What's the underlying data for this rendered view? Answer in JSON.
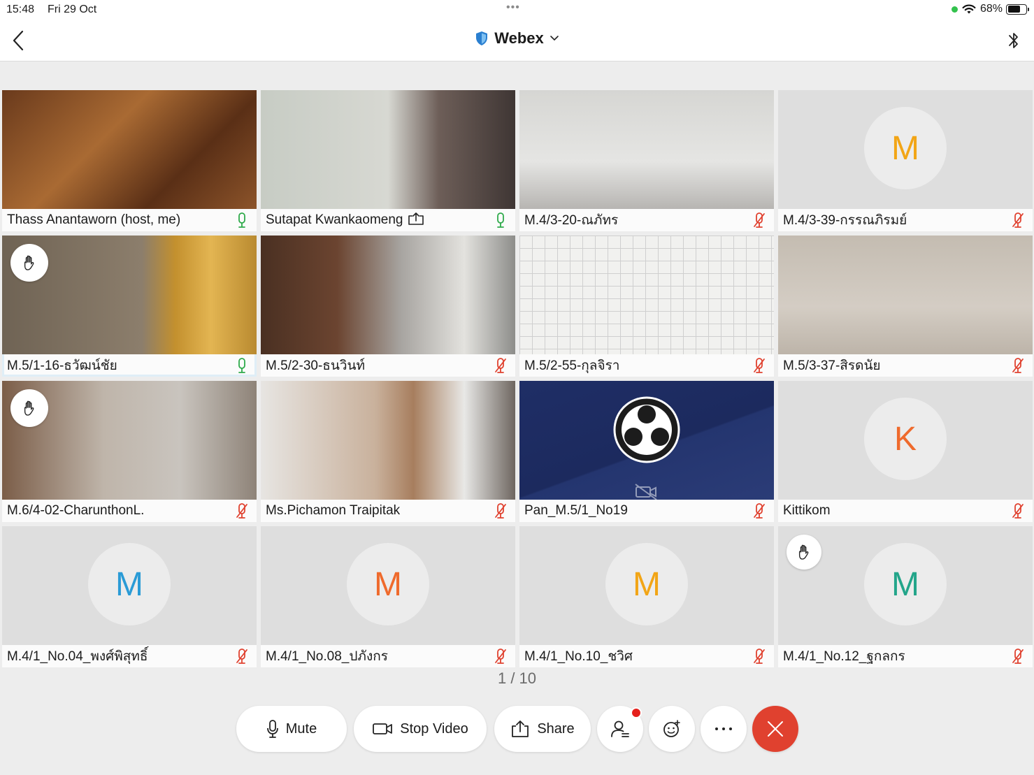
{
  "status_bar": {
    "time": "15:48",
    "date": "Fri 29 Oct",
    "dots": "•••",
    "battery": "68%",
    "battery_level": 0.68
  },
  "nav": {
    "title": "Webex",
    "back_icon": "chevron-left-icon",
    "bluetooth_icon": "bluetooth-icon"
  },
  "colors": {
    "active_border": "#1f86c4",
    "mic_on": "#2eaa4a",
    "mic_off": "#e0412f",
    "end_call": "#e0412f"
  },
  "participants": [
    {
      "name": "Thass Anantaworn (host, me)",
      "mic": "on",
      "video": true
    },
    {
      "name": "Sutapat Kwankaomeng",
      "mic": "on",
      "video": true,
      "sharing_icon": true
    },
    {
      "name": "M.4/3-20-ณภัทร",
      "mic": "off",
      "video": true
    },
    {
      "name": "M.4/3-39-กรรณภิรมย์",
      "mic": "off",
      "avatar": "M",
      "avatar_color": "#f2a516"
    },
    {
      "name": "M.5/1-16-ธวัฒน์ชัย",
      "mic": "on",
      "video": true,
      "raised_hand": true,
      "active": true
    },
    {
      "name": "M.5/2-30-ธนวินท์",
      "mic": "off",
      "video": true
    },
    {
      "name": "M.5/2-55-กุลจิรา",
      "mic": "off",
      "video": true
    },
    {
      "name": "M.5/3-37-สิรดนัย",
      "mic": "off",
      "video": true
    },
    {
      "name": "M.6/4-02-CharunthonL.",
      "mic": "off",
      "video": true,
      "raised_hand": true
    },
    {
      "name": "Ms.Pichamon Traipitak",
      "mic": "off",
      "video": true
    },
    {
      "name": "Pan_M.5/1_No19",
      "mic": "off",
      "video": true,
      "obs_logo": true
    },
    {
      "name": "Kittikom",
      "mic": "off",
      "avatar": "K",
      "avatar_color": "#ef6a2c"
    },
    {
      "name": "M.4/1_No.04_พงศ์พิสุทธิ์",
      "mic": "off",
      "avatar": "M",
      "avatar_color": "#2a9bd6"
    },
    {
      "name": "M.4/1_No.08_ปภังกร",
      "mic": "off",
      "avatar": "M",
      "avatar_color": "#ef6a2c"
    },
    {
      "name": "M.4/1_No.10_ชวิศ",
      "mic": "off",
      "avatar": "M",
      "avatar_color": "#f2a516"
    },
    {
      "name": "M.4/1_No.12_ฐกลกร",
      "mic": "off",
      "avatar": "M",
      "avatar_color": "#23a58a",
      "raised_hand": true
    }
  ],
  "pagination": "1 / 10",
  "toolbar": {
    "mute_label": "Mute",
    "stop_video_label": "Stop Video",
    "share_label": "Share",
    "participants_icon": "participants-icon",
    "reactions_icon": "emoji-icon",
    "more_icon": "more-icon",
    "end_icon": "close-icon"
  }
}
